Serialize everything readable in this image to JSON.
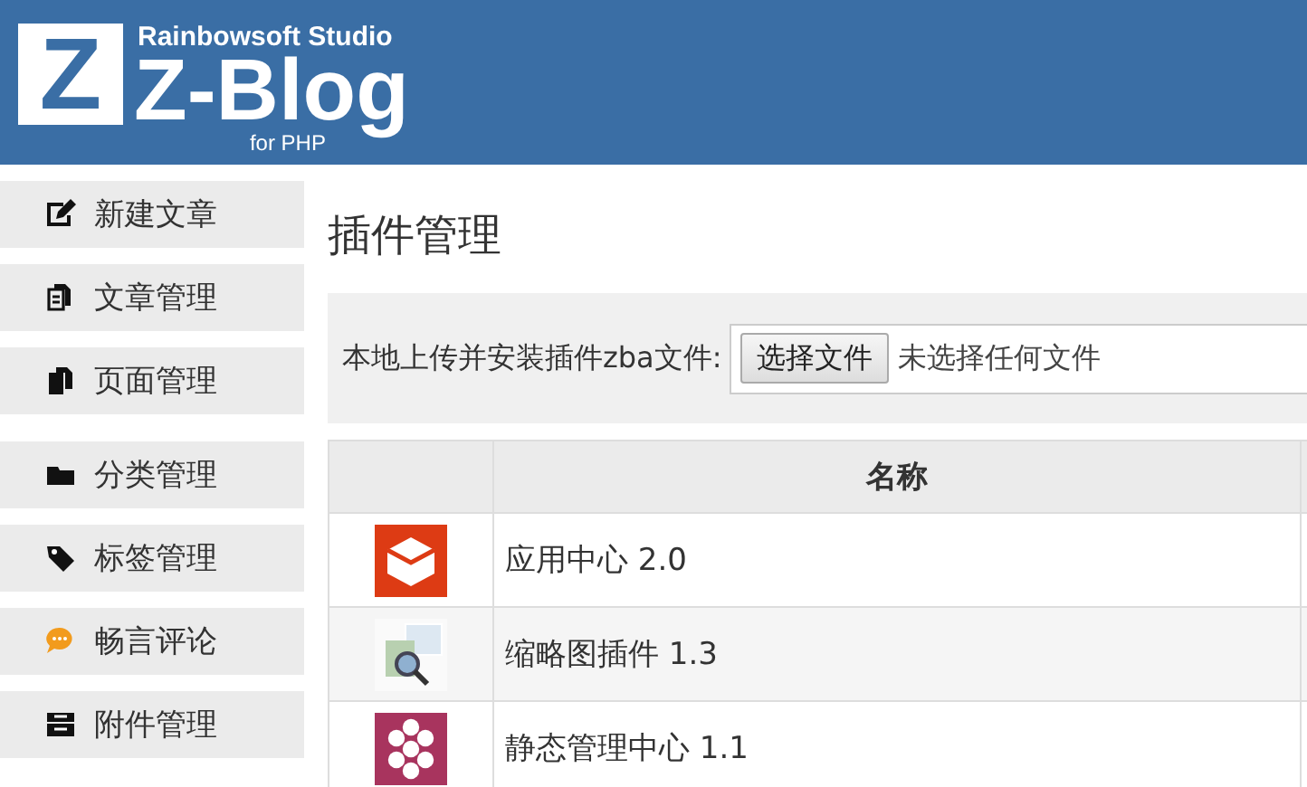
{
  "header": {
    "studio": "Rainbowsoft Studio",
    "logo_letter": "Z",
    "product": "Z-Blog",
    "edition": "for PHP"
  },
  "sidebar": {
    "groups": [
      [
        {
          "label": "新建文章",
          "kind": "edit"
        },
        {
          "label": "文章管理",
          "kind": "docs"
        },
        {
          "label": "页面管理",
          "kind": "page"
        }
      ],
      [
        {
          "label": "分类管理",
          "kind": "folder"
        },
        {
          "label": "标签管理",
          "kind": "tag"
        },
        {
          "label": "畅言评论",
          "kind": "chat"
        },
        {
          "label": "附件管理",
          "kind": "archive"
        }
      ]
    ]
  },
  "page_title": "插件管理",
  "upload": {
    "label": "本地上传并安装插件zba文件:",
    "button": "选择文件",
    "value": "未选择任何文件"
  },
  "table": {
    "columns": [
      "名称"
    ],
    "rows": [
      {
        "kind": "box",
        "name": "应用中心 2.0"
      },
      {
        "kind": "thumbnail",
        "name": "缩略图插件 1.3"
      },
      {
        "kind": "hexagons",
        "name": "静态管理中心 1.1"
      }
    ]
  }
}
